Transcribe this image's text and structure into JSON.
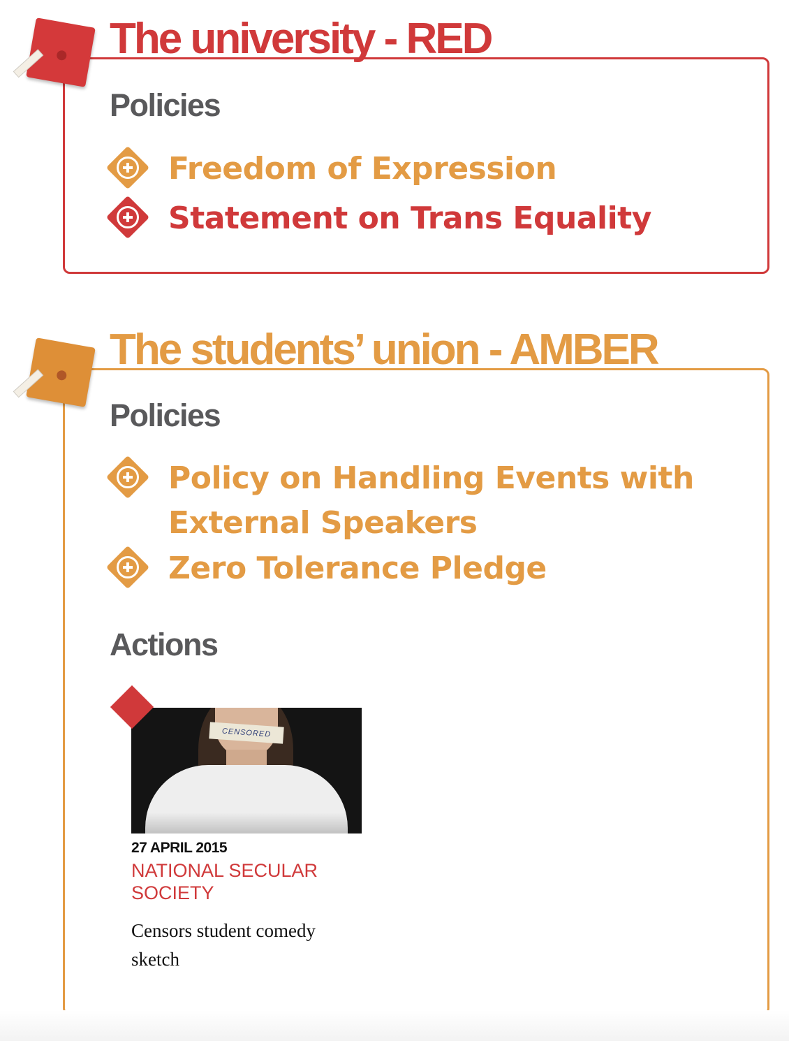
{
  "colors": {
    "red": "#d0393a",
    "amber": "#e39b44",
    "heading_gray": "#59595b"
  },
  "sections": [
    {
      "title": "The university - RED",
      "status": "RED",
      "icon": "graduation-cap-icon",
      "policies_heading": "Policies",
      "policies": [
        {
          "label": "Freedom of Expression",
          "color": "amber",
          "icon": "plus-diamond-icon"
        },
        {
          "label": "Statement on Trans Equality",
          "color": "red",
          "icon": "plus-diamond-icon"
        }
      ]
    },
    {
      "title": "The students’ union - AMBER",
      "status": "AMBER",
      "icon": "graduation-cap-icon",
      "policies_heading": "Policies",
      "policies": [
        {
          "label": "Policy on Handling Events with External Speakers",
          "color": "amber",
          "icon": "plus-diamond-icon"
        },
        {
          "label": "Zero Tolerance Pledge",
          "color": "amber",
          "icon": "plus-diamond-icon"
        }
      ],
      "actions_heading": "Actions",
      "actions": [
        {
          "date": "27 APRIL 2015",
          "organisation": "NATIONAL SECULAR SOCIETY",
          "description": "Censors student comedy sketch",
          "image_caption_text": "CENSORED",
          "color": "red"
        }
      ]
    }
  ]
}
